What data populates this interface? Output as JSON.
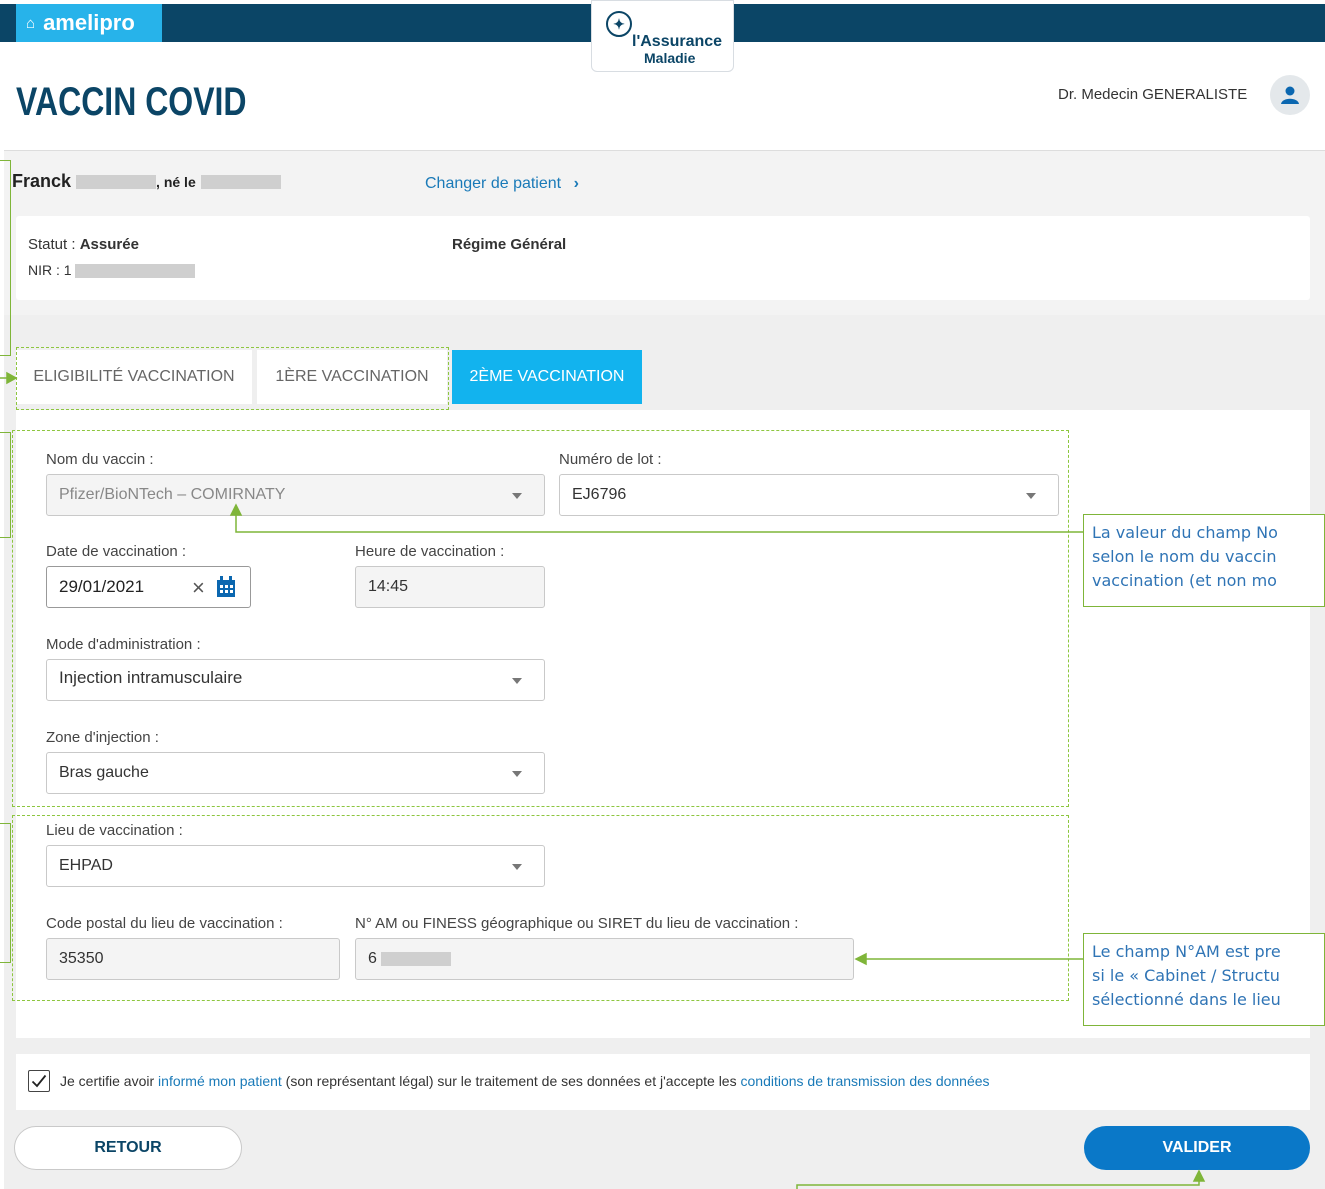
{
  "header": {
    "brand": "amelipro",
    "logo_line1": "l'Assurance",
    "logo_line2": "Maladie",
    "page_title": "VACCIN COVID",
    "user_name": "Dr. Medecin GENERALISTE"
  },
  "patient": {
    "first_name": "Franck",
    "born_label": ", né le",
    "change_link": "Changer de patient",
    "statut_label": "Statut : ",
    "statut_value": "Assurée",
    "nir_label": "NIR : 1",
    "regime": "Régime Général"
  },
  "tabs": [
    {
      "label": "ELIGIBILITÉ VACCINATION",
      "active": false
    },
    {
      "label": "1ÈRE VACCINATION",
      "active": false
    },
    {
      "label": "2ÈME VACCINATION",
      "active": true
    }
  ],
  "form": {
    "vaccine_label": "Nom du vaccin :",
    "vaccine_value": "Pfizer/BioNTech – COMIRNATY",
    "lot_label": "Numéro de lot :",
    "lot_value": "EJ6796",
    "date_label": "Date de vaccination :",
    "date_value": "29/01/2021",
    "time_label": "Heure de vaccination :",
    "time_value": "14:45",
    "mode_label": "Mode d'administration :",
    "mode_value": "Injection intramusculaire",
    "zone_label": "Zone d'injection :",
    "zone_value": "Bras gauche",
    "lieu_label": "Lieu de vaccination :",
    "lieu_value": "EHPAD",
    "cp_label": "Code postal du lieu de vaccination :",
    "cp_value": "35350",
    "nam_label": "N° AM ou FINESS géographique ou SIRET du lieu de vaccination :",
    "nam_value": "6"
  },
  "callouts": {
    "a_line1": "La valeur du champ No",
    "a_line2": "selon le nom du vaccin",
    "a_line3": "vaccination (et non mo",
    "b_line1": "Le champ N°AM est pre",
    "b_line2": "si le « Cabinet / Structu",
    "b_line3": "sélectionné dans le lieu"
  },
  "certification": {
    "checked": true,
    "text_1": "Je certifie avoir ",
    "link_1": "informé mon patient",
    "text_2": " (son représentant légal) sur le traitement de ses données et j'accepte les ",
    "link_2": "conditions de transmission des données"
  },
  "actions": {
    "back": "RETOUR",
    "submit": "VALIDER"
  },
  "colors": {
    "navy": "#0b4566",
    "sky": "#27b3ea",
    "active_tab": "#12b3ee",
    "link": "#1a7ab8",
    "annotation_green": "#7fb539",
    "submit_blue": "#0a78c8"
  }
}
